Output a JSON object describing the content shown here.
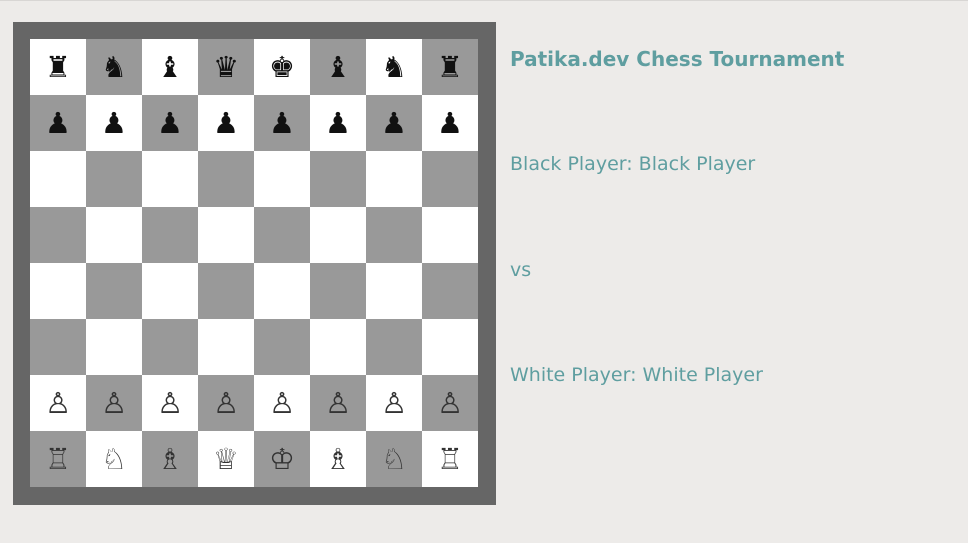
{
  "title": "Patika.dev Chess Tournament",
  "black_player_line": "Black Player: Black Player",
  "vs_label": "vs",
  "white_player_line": "White Player: White Player",
  "colors": {
    "page_background": "#edebe9",
    "board_border": "#666666",
    "light_square": "#ffffff",
    "dark_square": "#999999",
    "text_accent": "#5f9ea0"
  },
  "board": {
    "ranks": [
      [
        "r",
        "n",
        "b",
        "q",
        "k",
        "b",
        "n",
        "r"
      ],
      [
        "p",
        "p",
        "p",
        "p",
        "p",
        "p",
        "p",
        "p"
      ],
      [
        "",
        "",
        "",
        "",
        "",
        "",
        "",
        ""
      ],
      [
        "",
        "",
        "",
        "",
        "",
        "",
        "",
        ""
      ],
      [
        "",
        "",
        "",
        "",
        "",
        "",
        "",
        ""
      ],
      [
        "",
        "",
        "",
        "",
        "",
        "",
        "",
        ""
      ],
      [
        "P",
        "P",
        "P",
        "P",
        "P",
        "P",
        "P",
        "P"
      ],
      [
        "R",
        "N",
        "B",
        "Q",
        "K",
        "B",
        "N",
        "R"
      ]
    ],
    "piece_glyphs": {
      "k": "♚",
      "q": "♛",
      "r": "♜",
      "b": "♝",
      "n": "♞",
      "p": "♟",
      "K": "♔",
      "Q": "♕",
      "R": "♖",
      "B": "♗",
      "N": "♘",
      "P": "♙"
    },
    "piece_names": {
      "k": "black-king",
      "q": "black-queen",
      "r": "black-rook",
      "b": "black-bishop",
      "n": "black-knight",
      "p": "black-pawn",
      "K": "white-king",
      "Q": "white-queen",
      "R": "white-rook",
      "B": "white-bishop",
      "N": "white-knight",
      "P": "white-pawn"
    }
  }
}
